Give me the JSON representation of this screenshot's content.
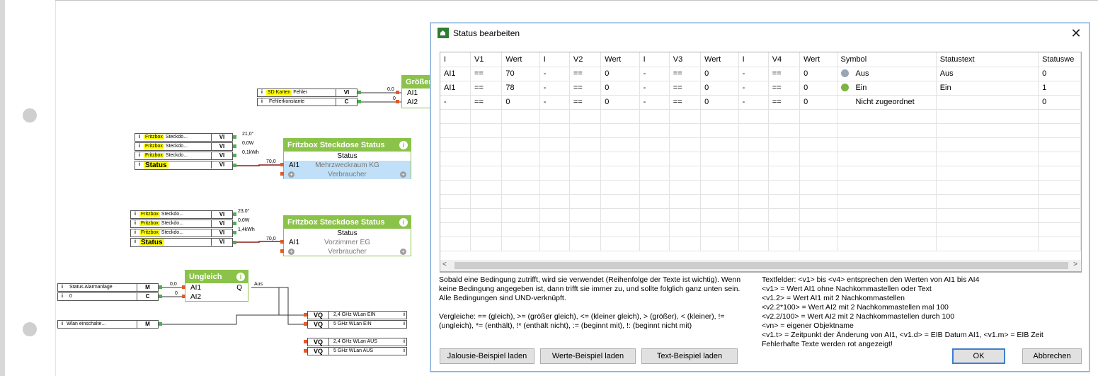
{
  "canvas": {
    "blocks": {
      "groesser": {
        "title": "Größer",
        "inputs": [
          "AI1",
          "AI2"
        ]
      },
      "fritz1": {
        "title": "Fritzbox Steckdose Status",
        "subtitle": "Status",
        "input": "AI1",
        "name": "Mehrzweckraum KG",
        "consumer": "Verbraucher"
      },
      "fritz2": {
        "title": "Fritzbox Steckdose Status",
        "subtitle": "Status",
        "input": "AI1",
        "name": "Vorzimmer EG",
        "consumer": "Verbraucher"
      },
      "ungleich": {
        "title": "Ungleich",
        "inputs": [
          "AI1",
          "AI2"
        ],
        "output": "Q",
        "output_label": "Aus"
      }
    },
    "inputs_top": [
      {
        "hl": "SD Karten",
        "text": "Fehler",
        "type": "VI",
        "value": "0,0"
      },
      {
        "hl": "",
        "text": "Fehlerkonstante",
        "type": "C",
        "value": "0"
      }
    ],
    "inputs_fritz1": [
      {
        "hl": "Fritzbox",
        "text": "Steckdo...",
        "type": "VI",
        "value": "21,0°"
      },
      {
        "hl": "Fritzbox",
        "text": "Steckdo...",
        "type": "VI",
        "value": "0,0W"
      },
      {
        "hl": "Fritzbox",
        "text": "Steckdo...",
        "type": "VI",
        "value": "0,1kWh"
      },
      {
        "hl": "Status",
        "text": "",
        "type": "VI",
        "value": "70,0"
      }
    ],
    "inputs_fritz2": [
      {
        "hl": "Fritzbox",
        "text": "Steckdo...",
        "type": "VI",
        "value": "23,0°"
      },
      {
        "hl": "Fritzbox",
        "text": "Steckdo...",
        "type": "VI",
        "value": "0,0W"
      },
      {
        "hl": "Fritzbox",
        "text": "Steckdo...",
        "type": "VI",
        "value": "1,4kWh"
      },
      {
        "hl": "Status",
        "text": "",
        "type": "VI",
        "value": "70,0"
      }
    ],
    "inputs_ungleich": [
      {
        "hl": "",
        "text": "Status Alarmanlage",
        "type": "M",
        "value": "0,0"
      },
      {
        "hl": "",
        "text": "0",
        "type": "C",
        "value": "0"
      }
    ],
    "input_wlan": {
      "hl": "",
      "text": "Wlan einschalte...",
      "type": "M"
    },
    "outputs": [
      {
        "type": "VQ",
        "text": "2,4 GHz WLan EIN"
      },
      {
        "type": "VQ",
        "text": "5 GHz WLan EIN"
      },
      {
        "type": "VQ",
        "text": "2,4 GHz WLan AUS"
      },
      {
        "type": "VQ",
        "text": "5 GHz WLan AUS"
      }
    ],
    "info_letter": "i"
  },
  "dialog": {
    "title": "Status bearbeiten",
    "close_glyph": "✕",
    "columns": [
      "I",
      "V1",
      "Wert",
      "I",
      "V2",
      "Wert",
      "I",
      "V3",
      "Wert",
      "I",
      "V4",
      "Wert",
      "Symbol",
      "Statustext",
      "Statuswe"
    ],
    "rows": [
      {
        "i1": "AI1",
        "v1": "==",
        "w1": "70",
        "i2": "-",
        "v2": "==",
        "w2": "0",
        "i3": "-",
        "v3": "==",
        "w3": "0",
        "i4": "-",
        "v4": "==",
        "w4": "0",
        "symbol_icon": "off",
        "symbol": "Aus",
        "statustext": "Aus",
        "statuswert": "0"
      },
      {
        "i1": "AI1",
        "v1": "==",
        "w1": "78",
        "i2": "-",
        "v2": "==",
        "w2": "0",
        "i3": "-",
        "v3": "==",
        "w3": "0",
        "i4": "-",
        "v4": "==",
        "w4": "0",
        "symbol_icon": "on",
        "symbol": "Ein",
        "statustext": "Ein",
        "statuswert": "1"
      },
      {
        "i1": "-",
        "v1": "==",
        "w1": "0",
        "i2": "-",
        "v2": "==",
        "w2": "0",
        "i3": "-",
        "v3": "==",
        "w3": "0",
        "i4": "-",
        "v4": "==",
        "w4": "0",
        "symbol_icon": "none",
        "symbol": "Nicht zugeordnet",
        "statustext": "",
        "statuswert": "0"
      }
    ],
    "scroll_left": "<",
    "scroll_right": ">",
    "help_left": [
      "Sobald eine Bedingung zutrifft, wird sie verwendet (Reihenfolge der Texte ist wichtig). Wenn",
      "keine Bedingung angegeben ist, dann trifft sie immer zu, und sollte folglich ganz unten sein.",
      "Alle Bedingungen sind UND-verknüpft.",
      "",
      "Vergleiche: == (gleich), >= (größer gleich), <= (kleiner gleich), > (größer), < (kleiner), !=",
      "(ungleich), *= (enthält), !* (enthält nicht), := (beginnt mit), !: (beginnt nicht mit)"
    ],
    "help_right": [
      "Textfelder: <v1> bis <v4> entsprechen den Werten von AI1 bis AI4",
      "<v1> = Wert AI1 ohne Nachkommastellen oder Text",
      "<v1.2> = Wert AI1 mit 2 Nachkommastellen",
      "<v2.2*100> = Wert AI2 mit 2 Nachkommastellen mal 100",
      "<v2.2/100> = Wert AI2 mit 2 Nachkommastellen durch 100",
      "<vn> = eigener Objektname",
      "<v1.t> = Zeitpunkt der Änderung von AI1, <v1.d> = EIB Datum AI1, <v1.m> = EIB Zeit",
      "Fehlerhafte Texte werden rot angezeigt!"
    ],
    "buttons": {
      "jalousie": "Jalousie-Beispiel laden",
      "werte": "Werte-Beispiel laden",
      "text": "Text-Beispiel laden",
      "ok": "OK",
      "cancel": "Abbrechen"
    }
  }
}
